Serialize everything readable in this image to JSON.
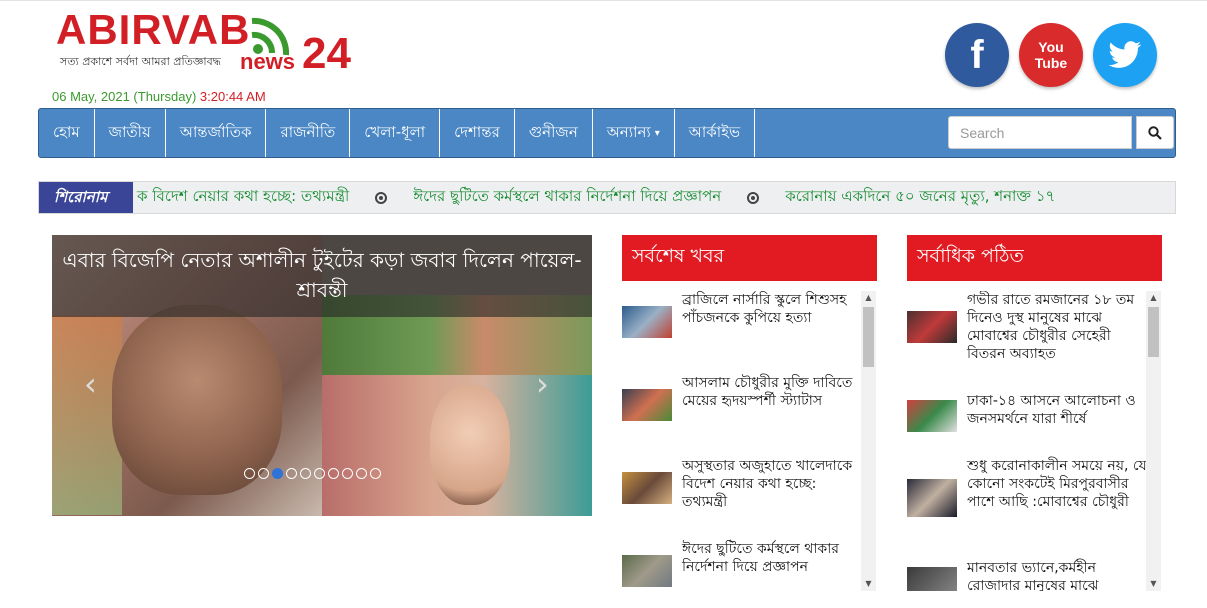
{
  "site": {
    "logo_text": "ABIRVAB",
    "logo_news": "news",
    "logo_num": "24",
    "tagline": "সত্য প্রকাশে সর্বদা আমরা প্রতিজ্ঞাবদ্ধ",
    "date": "06 May, 2021 (Thursday)",
    "time": "3:20:44 AM"
  },
  "social": {
    "facebook": "f",
    "youtube_top": "You",
    "youtube_bottom": "Tube",
    "twitter_icon": "twitter-bird-icon"
  },
  "nav": {
    "items": [
      "হোম",
      "জাতীয়",
      "আন্তর্জাতিক",
      "রাজনীতি",
      "খেলা-ধূলা",
      "দেশান্তর",
      "গুনীজন",
      "অন্যান্য",
      "আর্কাইভ"
    ],
    "dropdown_caret": "▾",
    "search_placeholder": "Search"
  },
  "ticker": {
    "label": "শিরোনাম",
    "items": [
      "ক বিদেশ নেয়ার কথা হচ্ছে: তথ্যমন্ত্রী",
      "ঈদের ছুটিতে কর্মস্থলে থাকার নির্দেশনা দিয়ে প্রজ্ঞাপন",
      "করোনায় একদিনে ৫০ জনের মৃত্যু, শনাক্ত ১৭"
    ]
  },
  "slider": {
    "caption": "এবার বিজেপি নেতার অশালীন টুইটের কড়া জবাব দিলেন পায়েল-শ্রাবন্তী",
    "prev": "‹",
    "next": "›",
    "dot_count": 10,
    "active_dot": 2
  },
  "latest": {
    "heading": "সর্বশেষ খবর",
    "items": [
      "ব্রাজিলে নার্সারি স্কুলে শিশুসহ পাঁচজনকে কুপিয়ে হত্যা",
      "আসলাম চৌধুরীর মুক্তি দাবিতে মেয়ের হৃদয়স্পর্শী স্ট্যাটাস",
      "অসুস্থতার অজুহাতে খালেদাকে বিদেশ নেয়ার কথা হচ্ছে: তথ্যমন্ত্রী",
      "ঈদের ছুটিতে কর্মস্থলে থাকার নির্দেশনা দিয়ে প্রজ্ঞাপন"
    ]
  },
  "most_read": {
    "heading": "সর্বাধিক পঠিত",
    "items": [
      "গভীর রাতে রমজানের ১৮ তম দিনেও দুস্থ মানুষের মাঝে মোবাশ্বের চৌধুরীর সেহেরী বিতরন অব্যাহত",
      "ঢাকা-১৪ আসনে আলোচনা ও জনসমর্থনে যারা শীর্ষে",
      "শুধু করোনাকালীন সময়ে নয়, যে কোনো সংকটেই মিরপুরবাসীর পাশে আছি :মোবাশ্বের চৌধুরী",
      "মানবতার ভ্যানে,কর্মহীন রোজাদার মানুষের মাঝে"
    ]
  },
  "colors": {
    "brand_red": "#d21f26",
    "nav_blue": "#4a87c4",
    "ticker_label": "#3a4598",
    "ticker_text": "#138a2e"
  }
}
